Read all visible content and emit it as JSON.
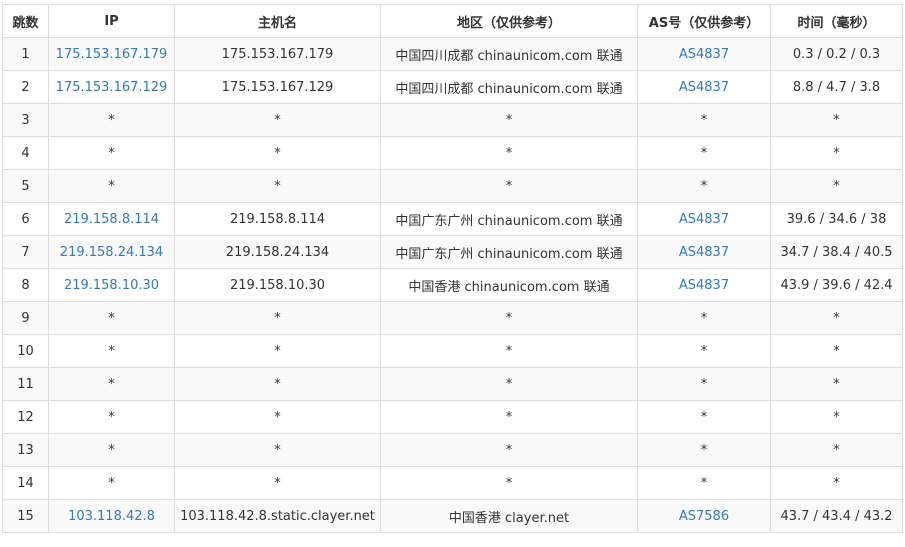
{
  "headers": [
    "跳数",
    "IP",
    "主机名",
    "地区（仅供参考）",
    "AS号（仅供参考）",
    "时间（毫秒）"
  ],
  "rows": [
    {
      "hop": "1",
      "ip": "175.153.167.179",
      "host": "175.153.167.179",
      "region": "中国四川成都 chinaunicom.com 联通",
      "as": "AS4837",
      "time": "0.3 / 0.2 / 0.3"
    },
    {
      "hop": "2",
      "ip": "175.153.167.129",
      "host": "175.153.167.129",
      "region": "中国四川成都 chinaunicom.com 联通",
      "as": "AS4837",
      "time": "8.8 / 4.7 / 3.8"
    },
    {
      "hop": "3",
      "ip": "*",
      "host": "*",
      "region": "*",
      "as": "*",
      "time": "*"
    },
    {
      "hop": "4",
      "ip": "*",
      "host": "*",
      "region": "*",
      "as": "*",
      "time": "*"
    },
    {
      "hop": "5",
      "ip": "*",
      "host": "*",
      "region": "*",
      "as": "*",
      "time": "*"
    },
    {
      "hop": "6",
      "ip": "219.158.8.114",
      "host": "219.158.8.114",
      "region": "中国广东广州 chinaunicom.com 联通",
      "as": "AS4837",
      "time": "39.6 / 34.6 / 38"
    },
    {
      "hop": "7",
      "ip": "219.158.24.134",
      "host": "219.158.24.134",
      "region": "中国广东广州 chinaunicom.com 联通",
      "as": "AS4837",
      "time": "34.7 / 38.4 / 40.5"
    },
    {
      "hop": "8",
      "ip": "219.158.10.30",
      "host": "219.158.10.30",
      "region": "中国香港 chinaunicom.com 联通",
      "as": "AS4837",
      "time": "43.9 / 39.6 / 42.4"
    },
    {
      "hop": "9",
      "ip": "*",
      "host": "*",
      "region": "*",
      "as": "*",
      "time": "*"
    },
    {
      "hop": "10",
      "ip": "*",
      "host": "*",
      "region": "*",
      "as": "*",
      "time": "*"
    },
    {
      "hop": "11",
      "ip": "*",
      "host": "*",
      "region": "*",
      "as": "*",
      "time": "*"
    },
    {
      "hop": "12",
      "ip": "*",
      "host": "*",
      "region": "*",
      "as": "*",
      "time": "*"
    },
    {
      "hop": "13",
      "ip": "*",
      "host": "*",
      "region": "*",
      "as": "*",
      "time": "*"
    },
    {
      "hop": "14",
      "ip": "*",
      "host": "*",
      "region": "*",
      "as": "*",
      "time": "*"
    },
    {
      "hop": "15",
      "ip": "103.118.42.8",
      "host": "103.118.42.8.static.clayer.net",
      "region": "中国香港 clayer.net",
      "as": "AS7586",
      "time": "43.7 / 43.4 / 43.2"
    }
  ],
  "colors": {
    "link": "#337ab7",
    "text": "#333333",
    "border": "#dddddd",
    "stripe": "#f9f9f9"
  }
}
